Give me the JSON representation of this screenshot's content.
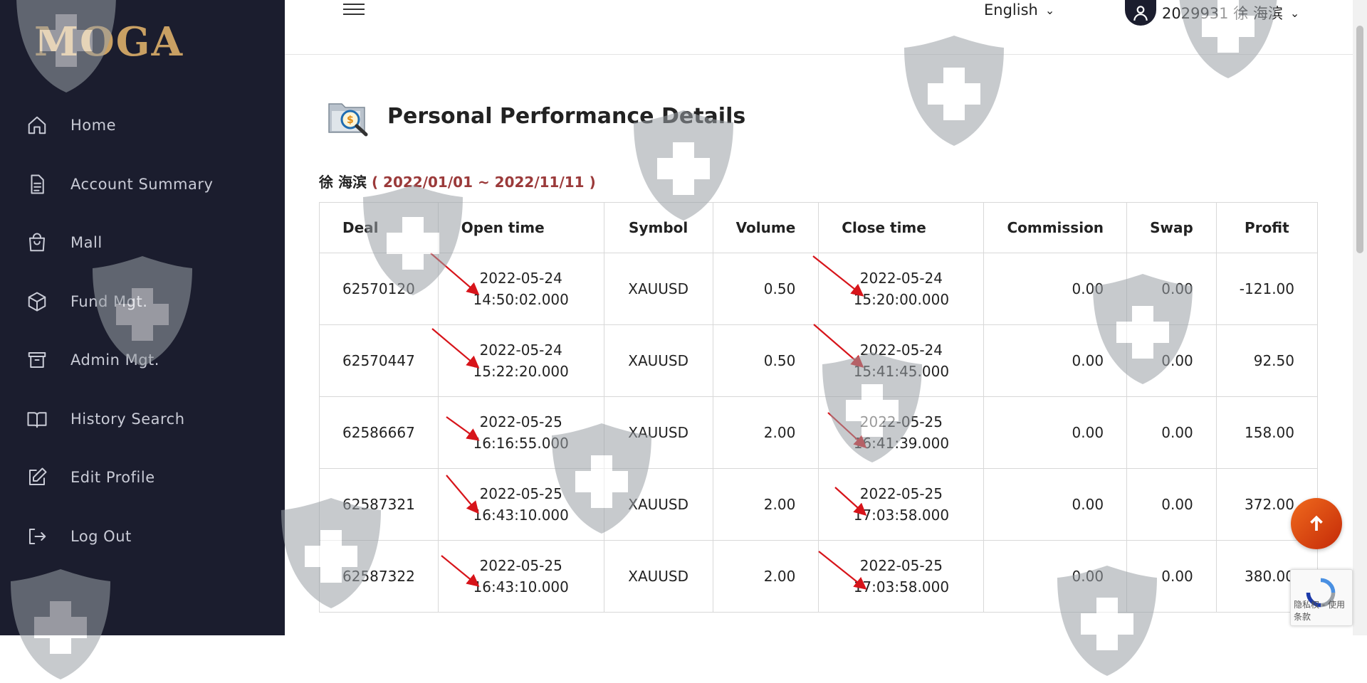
{
  "sidebar": {
    "logo_text": "MOGA",
    "items": [
      {
        "label": "Home",
        "icon": "home-icon"
      },
      {
        "label": "Account Summary",
        "icon": "document-icon"
      },
      {
        "label": "Mall",
        "icon": "shopping-bag-icon"
      },
      {
        "label": "Fund Mgt.",
        "icon": "box-icon"
      },
      {
        "label": "Admin Mgt.",
        "icon": "archive-icon"
      },
      {
        "label": "History Search",
        "icon": "book-icon"
      },
      {
        "label": "Edit Profile",
        "icon": "edit-icon"
      },
      {
        "label": "Log Out",
        "icon": "logout-icon"
      }
    ]
  },
  "topbar": {
    "language": "English",
    "user": "2029931 徐 海滨"
  },
  "main": {
    "title": "Personal Performance Details",
    "subtitle_name": "徐 海滨",
    "subtitle_range": "( 2022/01/01 ~ 2022/11/11 )"
  },
  "table": {
    "headers": [
      "Deal",
      "Open time",
      "Symbol",
      "Volume",
      "Close time",
      "Commission",
      "Swap",
      "Profit"
    ],
    "rows": [
      {
        "deal": "62570120",
        "open_date": "2022-05-24",
        "open_time": "14:50:02.000",
        "symbol": "XAUUSD",
        "volume": "0.50",
        "close_date": "2022-05-24",
        "close_time": "15:20:00.000",
        "commission": "0.00",
        "swap": "0.00",
        "profit": "-121.00"
      },
      {
        "deal": "62570447",
        "open_date": "2022-05-24",
        "open_time": "15:22:20.000",
        "symbol": "XAUUSD",
        "volume": "0.50",
        "close_date": "2022-05-24",
        "close_time": "15:41:45.000",
        "commission": "0.00",
        "swap": "0.00",
        "profit": "92.50"
      },
      {
        "deal": "62586667",
        "open_date": "2022-05-25",
        "open_time": "16:16:55.000",
        "symbol": "XAUUSD",
        "volume": "2.00",
        "close_date": "2022-05-25",
        "close_time": "16:41:39.000",
        "commission": "0.00",
        "swap": "0.00",
        "profit": "158.00"
      },
      {
        "deal": "62587321",
        "open_date": "2022-05-25",
        "open_time": "16:43:10.000",
        "symbol": "XAUUSD",
        "volume": "2.00",
        "close_date": "2022-05-25",
        "close_time": "17:03:58.000",
        "commission": "0.00",
        "swap": "0.00",
        "profit": "372.00"
      },
      {
        "deal": "62587322",
        "open_date": "2022-05-25",
        "open_time": "16:43:10.000",
        "symbol": "XAUUSD",
        "volume": "2.00",
        "close_date": "2022-05-25",
        "close_time": "17:03:58.000",
        "commission": "0.00",
        "swap": "0.00",
        "profit": "380.00"
      }
    ]
  },
  "widgets": {
    "recaptcha_text": "隐私权 - 使用条款"
  },
  "colors": {
    "sidebar_bg": "#1b1d2e",
    "logo_gold": "#c9a063",
    "range_red": "#9b3a3a",
    "annotation_red": "#d7141a",
    "scroll_top_orange": "#e4521a"
  }
}
